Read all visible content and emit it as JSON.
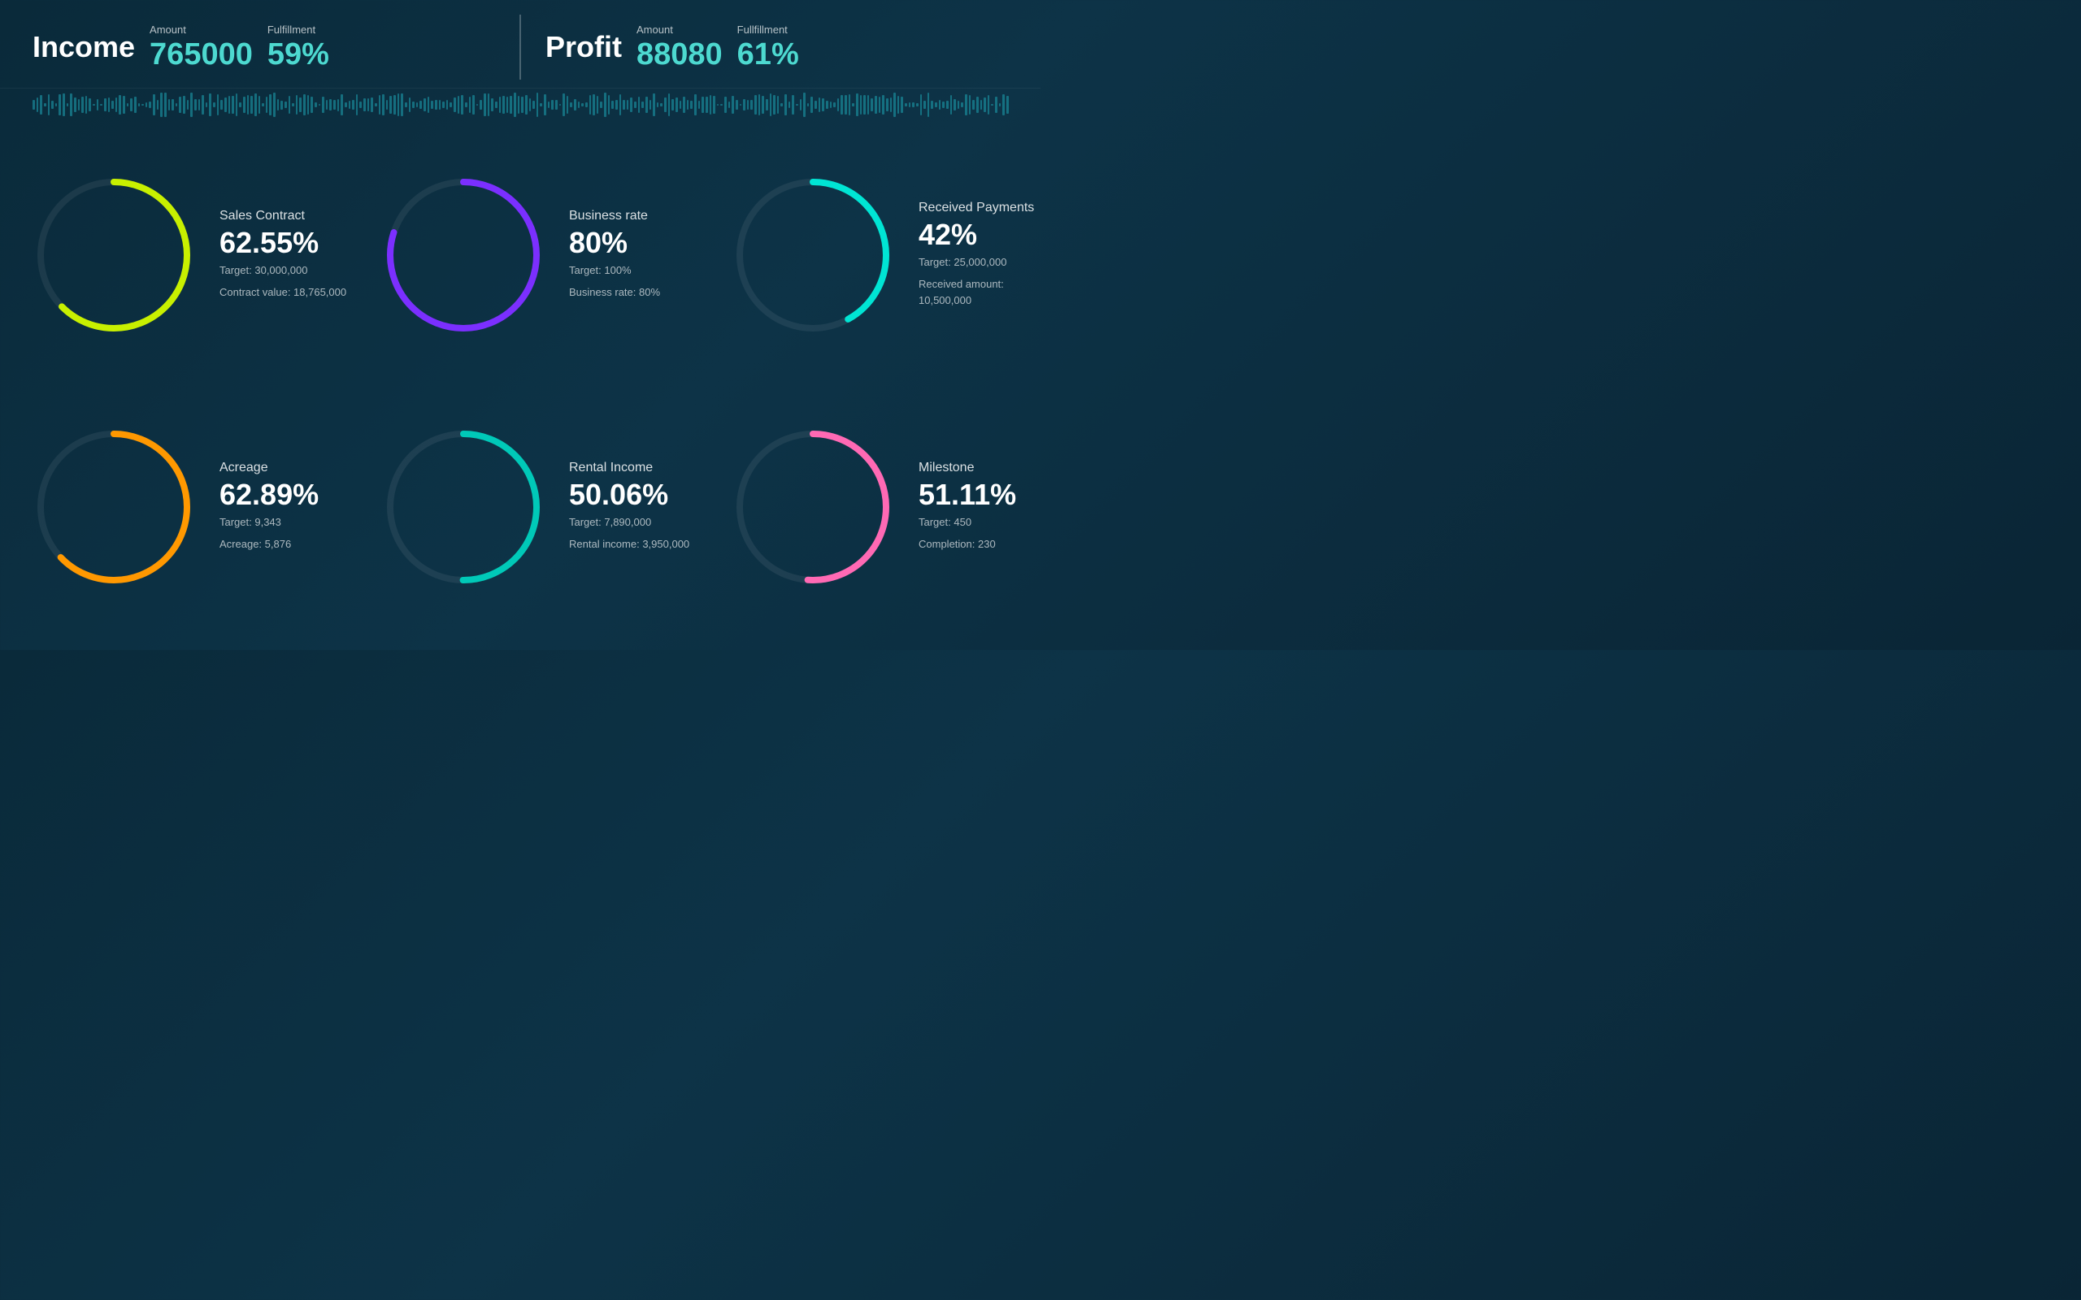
{
  "header": {
    "income": {
      "title": "Income",
      "amount_label": "Amount",
      "amount_value": "765000",
      "fulfillment_label": "Fulfillment",
      "fulfillment_value": "59%"
    },
    "profit": {
      "title": "Profit",
      "amount_label": "Amount",
      "amount_value": "88080",
      "fulfillment_label": "Fullfillment",
      "fulfillment_value": "61%"
    }
  },
  "cards": [
    {
      "id": "sales-contract",
      "title": "Sales Contract",
      "percent": "62.55%",
      "percent_num": 62.55,
      "details": [
        "Target:  30,000,000",
        "Contract value:  18,765,000"
      ],
      "color": "#c8f000",
      "dash_offset_factor": 0.3745
    },
    {
      "id": "business-rate",
      "title": "Business rate",
      "percent": "80%",
      "percent_num": 80,
      "details": [
        "Target:  100%",
        "Business rate:  80%"
      ],
      "color": "#7b2fff",
      "dash_offset_factor": 0.2
    },
    {
      "id": "received-payments",
      "title": "Received Payments",
      "percent": "42%",
      "percent_num": 42,
      "details": [
        "Target:  25,000,000",
        "Received amount:  10,500,000"
      ],
      "color": "#00e5d4",
      "dash_offset_factor": 0.58
    },
    {
      "id": "acreage",
      "title": "Acreage",
      "percent": "62.89%",
      "percent_num": 62.89,
      "details": [
        "Target:  9,343",
        "Acreage:  5,876"
      ],
      "color": "#ff9800",
      "dash_offset_factor": 0.3711
    },
    {
      "id": "rental-income",
      "title": "Rental Income",
      "percent": "50.06%",
      "percent_num": 50.06,
      "details": [
        "Target:  7,890,000",
        "Rental income:  3,950,000"
      ],
      "color": "#00c9b8",
      "dash_offset_factor": 0.4994
    },
    {
      "id": "milestone",
      "title": "Milestone",
      "percent": "51.11%",
      "percent_num": 51.11,
      "details": [
        "Target:  450",
        "Completion:  230"
      ],
      "color": "#ff69b4",
      "dash_offset_factor": 0.4889
    }
  ]
}
